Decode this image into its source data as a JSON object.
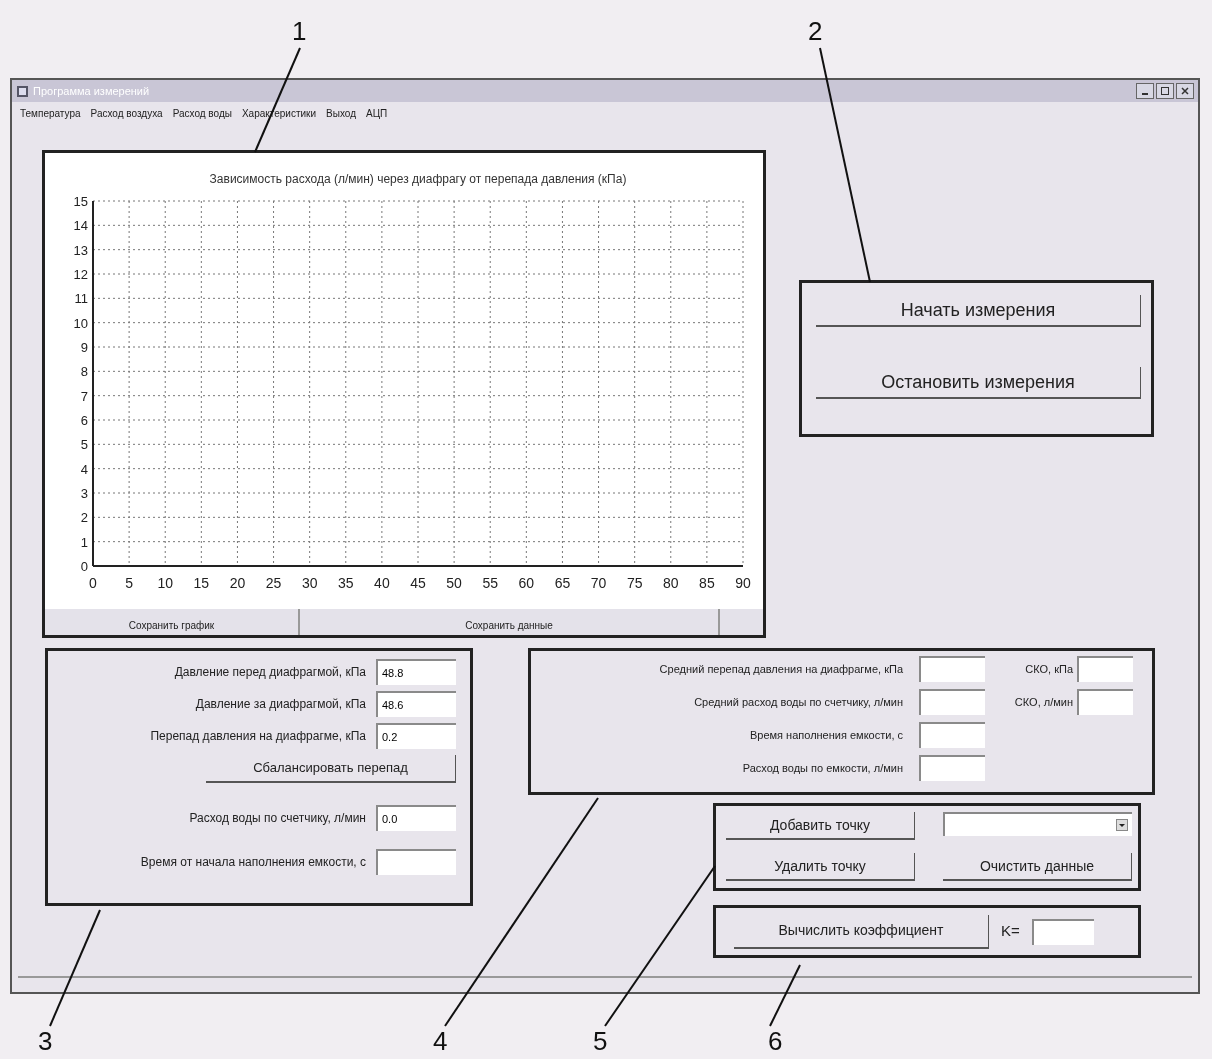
{
  "window": {
    "title": "Программа измерений"
  },
  "menu": [
    "Температура",
    "Расход воздуха",
    "Расход воды",
    "Характеристики",
    "Выход",
    "АЦП"
  ],
  "chart_panel": {
    "chart_data": {
      "type": "line",
      "grid": true,
      "title": "Зависимость расхода (л/мин) через диафрагу от перепада давления (кПа)",
      "xlim": [
        0,
        90
      ],
      "ylim": [
        0,
        15
      ],
      "xticks": [
        0,
        5,
        10,
        15,
        20,
        25,
        30,
        35,
        40,
        45,
        50,
        55,
        60,
        65,
        70,
        75,
        80,
        85,
        90
      ],
      "yticks": [
        0,
        1,
        2,
        3,
        4,
        5,
        6,
        7,
        8,
        9,
        10,
        11,
        12,
        13,
        14,
        15
      ]
    },
    "buttons": [
      "Сохранить график",
      "Сохранить данные"
    ]
  },
  "measurement_buttons": [
    "Начать измерения",
    "Остановить измерения"
  ],
  "pressure_panel": {
    "fields": [
      {
        "label": "Давление перед диафрагмой, кПа",
        "value": "48.8"
      },
      {
        "label": "Давление за диафрагмой, кПа",
        "value": "48.6"
      },
      {
        "label": "Перепад давления на диафрагме, кПа",
        "value": "0.2"
      }
    ],
    "button": "Сбалансировать перепад",
    "fields_2": [
      {
        "label": "Расход воды по счетчику, л/мин",
        "value": "0.0"
      },
      {
        "label": "Время от начала наполнения емкости, с"
      }
    ]
  },
  "averages_panel": {
    "rows": [
      {
        "label": "Средний перепад давления на диафрагме, кПа",
        "sd_label": "СКО, кПа"
      },
      {
        "label": "Средний расход воды по счетчику, л/мин",
        "sd_label": "СКО, л/мин"
      },
      {
        "label": "Время наполнения емкости, с"
      },
      {
        "label": "Расход воды по емкости, л/мин"
      }
    ]
  },
  "points_panel": {
    "add_button": "Добавить точку",
    "remove_button": "Удалить точку",
    "clear_button": "Очистить данные"
  },
  "coefficient_panel": {
    "button": "Вычислить коэффициент",
    "label": "K="
  },
  "callouts": [
    "1",
    "2",
    "3",
    "4",
    "5",
    "6"
  ]
}
